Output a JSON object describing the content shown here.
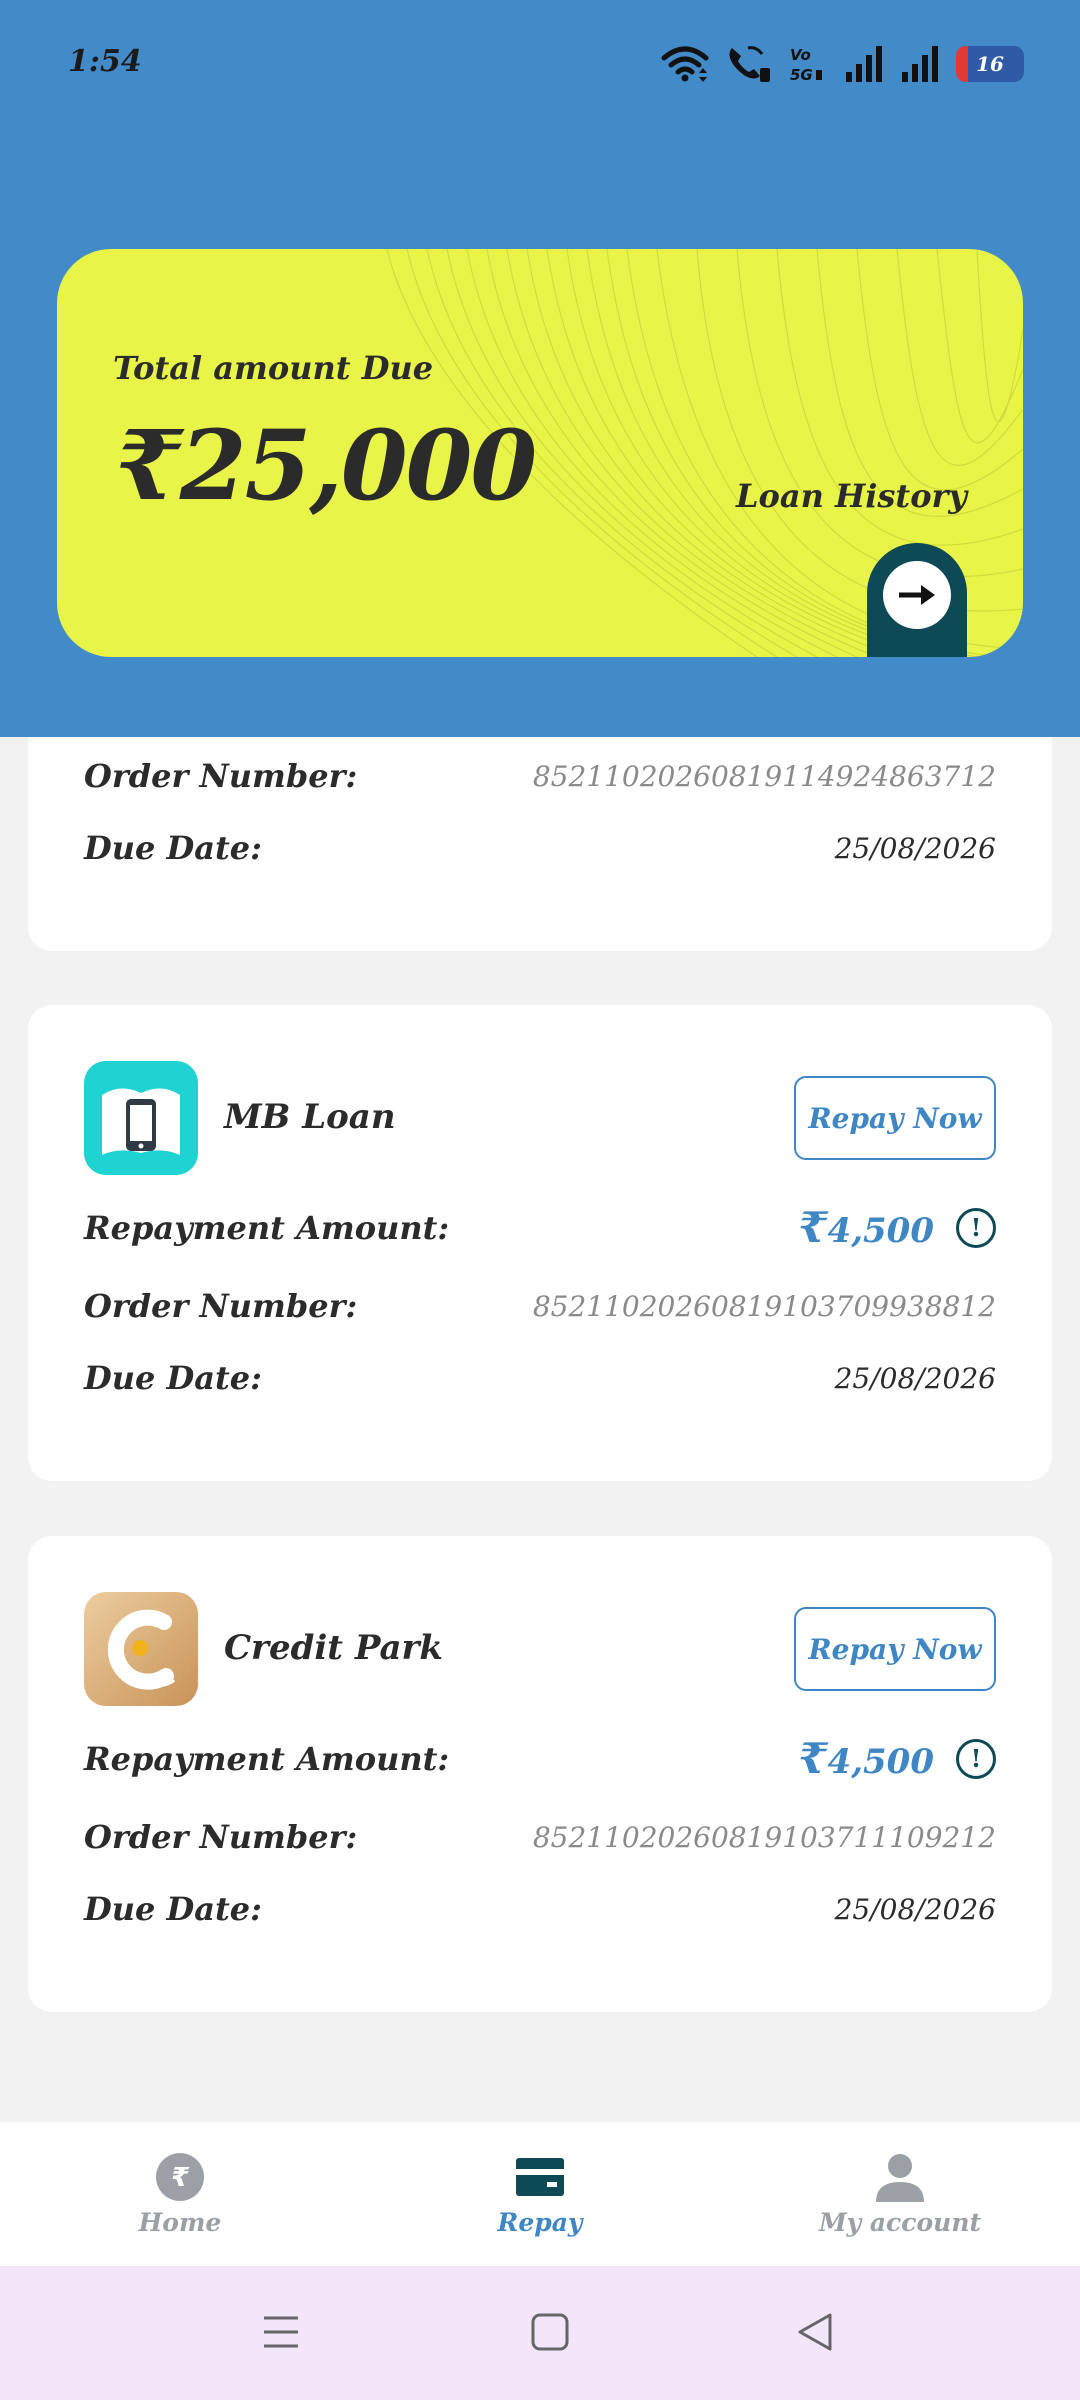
{
  "status_bar": {
    "time": "1:54",
    "battery_level": "16",
    "icons": [
      "wifi-icon",
      "wifi-call-icon",
      "volte-icon",
      "signal-icon",
      "signal-icon",
      "battery-icon"
    ]
  },
  "summary": {
    "total_label": "Total amount Due",
    "total_amount": "₹25,000",
    "history_label": "Loan History",
    "arrow_icon": "arrow-right-icon",
    "card_color": "#e8f548",
    "tab_color": "#0d4a56"
  },
  "partial_card": {
    "order_label": "Order Number:",
    "order_number": "85211020260819114924863712",
    "due_label": "Due Date:",
    "due_date": "25/08/2026"
  },
  "loans": [
    {
      "app_name": "MB Loan",
      "repay_label": "Repay Now",
      "amount_label": "Repayment Amount:",
      "amount_symbol": "₹",
      "amount": "4,500",
      "order_label": "Order Number:",
      "order_number": "85211020260819103709938812",
      "due_label": "Due Date:",
      "due_date": "25/08/2026",
      "logo_icon": "phone-book-icon",
      "logo_color": "#1fd3d3"
    },
    {
      "app_name": "Credit Park",
      "repay_label": "Repay Now",
      "amount_label": "Repayment Amount:",
      "amount_symbol": "₹",
      "amount": "4,500",
      "order_label": "Order Number:",
      "order_number": "85211020260819103711109212",
      "due_label": "Due Date:",
      "due_date": "25/08/2026",
      "logo_icon": "credit-c-icon",
      "logo_color": "#d9a96d"
    }
  ],
  "bottom_nav": {
    "items": [
      {
        "label": "Home",
        "icon": "rupee-coin-icon",
        "active": false
      },
      {
        "label": "Repay",
        "icon": "wallet-card-icon",
        "active": true
      },
      {
        "label": "My account",
        "icon": "person-icon",
        "active": false
      }
    ]
  },
  "system_nav": {
    "icons": [
      "menu-icon",
      "home-square-icon",
      "back-triangle-icon"
    ]
  },
  "colors": {
    "header": "#438ac9",
    "accent": "#3f86c4",
    "page_bg": "#f2f2f2"
  }
}
